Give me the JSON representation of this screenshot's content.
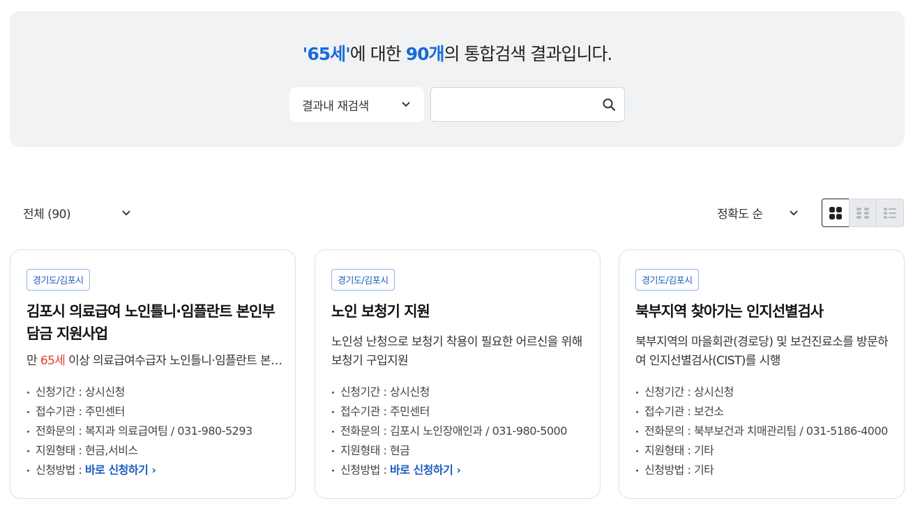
{
  "header": {
    "keyword": "'65세'",
    "text_mid": "에 대한 ",
    "count": "90개",
    "text_end": "의 통합검색 결과입니다."
  },
  "search": {
    "scope_label": "결과내 재검색",
    "input_value": "",
    "input_placeholder": ""
  },
  "filters": {
    "category": "전체 (90)",
    "sort": "정확도 순"
  },
  "view_modes": [
    "grid-large",
    "grid-small",
    "list"
  ],
  "cards": [
    {
      "tag": "경기도/김포시",
      "title": "김포시 의료급여 노인틀니·임플란트 본인부담금 지원사업",
      "desc_pre": "만 ",
      "desc_hl": "65세",
      "desc_post": " 이상 의료급여수급자 노인틀니·임플란트 본인부담금 지원",
      "period": "신청기간 : 상시신청",
      "agency": "접수기관 : 주민센터",
      "phone": "전화문의 : 복지과 의료급여팀 / 031-980-5293",
      "type": "지원형태 : 현금,서비스",
      "method_label": "신청방법 : ",
      "method_link": "바로 신청하기 ›"
    },
    {
      "tag": "경기도/김포시",
      "title": "노인 보청기 지원",
      "desc": "노인성 난청으로 보청기 착용이 필요한 어르신을 위해 보청기 구입지원",
      "period": "신청기간 : 상시신청",
      "agency": "접수기관 : 주민센터",
      "phone": "전화문의 : 김포시 노인장애인과 / 031-980-5000",
      "type": "지원형태 : 현금",
      "method_label": "신청방법 : ",
      "method_link": "바로 신청하기 ›"
    },
    {
      "tag": "경기도/김포시",
      "title": "북부지역 찾아가는 인지선별검사",
      "desc": "북부지역의 마을회관(경로당) 및 보건진료소를 방문하여 인지선별검사(CIST)를 시행",
      "period": "신청기간 : 상시신청",
      "agency": "접수기관 : 보건소",
      "phone": "전화문의 : 북부보건과 치매관리팀 / 031-5186-4000",
      "type": "지원형태 : 기타",
      "method": "신청방법 : 기타"
    }
  ]
}
